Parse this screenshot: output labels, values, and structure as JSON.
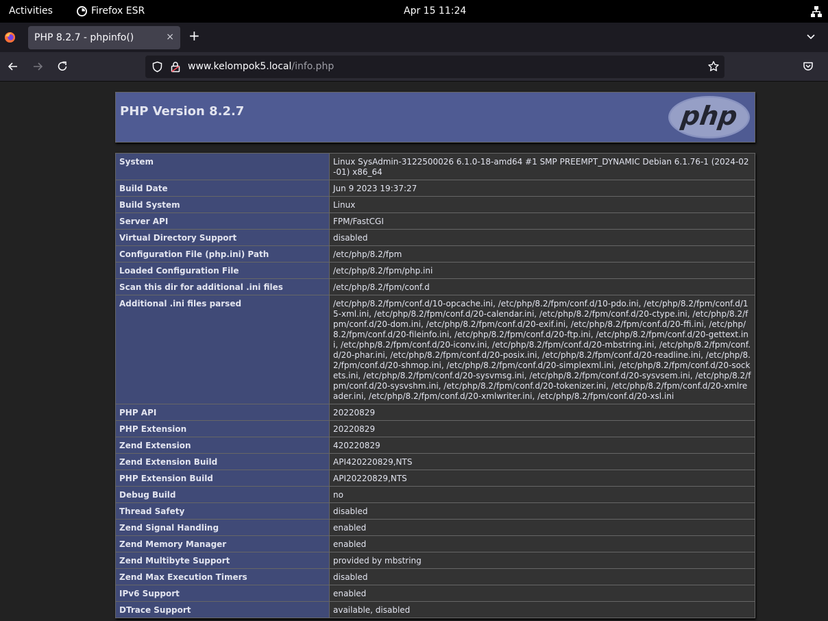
{
  "topbar": {
    "activities": "Activities",
    "app_name": "Firefox ESR",
    "clock": "Apr 15  11:24"
  },
  "browser": {
    "tab_title": "PHP 8.2.7 - phpinfo()",
    "tab_close": "×",
    "new_tab": "+",
    "url_host": "www.kelompok5.local",
    "url_path": "/info.php"
  },
  "page": {
    "heading": "PHP Version 8.2.7",
    "rows": [
      {
        "key": "System",
        "value": "Linux SysAdmin-3122500026 6.1.0-18-amd64 #1 SMP PREEMPT_DYNAMIC Debian 6.1.76-1 (2024-02-01) x86_64"
      },
      {
        "key": "Build Date",
        "value": "Jun 9 2023 19:37:27"
      },
      {
        "key": "Build System",
        "value": "Linux"
      },
      {
        "key": "Server API",
        "value": "FPM/FastCGI"
      },
      {
        "key": "Virtual Directory Support",
        "value": "disabled"
      },
      {
        "key": "Configuration File (php.ini) Path",
        "value": "/etc/php/8.2/fpm"
      },
      {
        "key": "Loaded Configuration File",
        "value": "/etc/php/8.2/fpm/php.ini"
      },
      {
        "key": "Scan this dir for additional .ini files",
        "value": "/etc/php/8.2/fpm/conf.d"
      },
      {
        "key": "Additional .ini files parsed",
        "value": "/etc/php/8.2/fpm/conf.d/10-opcache.ini, /etc/php/8.2/fpm/conf.d/10-pdo.ini, /etc/php/8.2/fpm/conf.d/15-xml.ini, /etc/php/8.2/fpm/conf.d/20-calendar.ini, /etc/php/8.2/fpm/conf.d/20-ctype.ini, /etc/php/8.2/fpm/conf.d/20-dom.ini, /etc/php/8.2/fpm/conf.d/20-exif.ini, /etc/php/8.2/fpm/conf.d/20-ffi.ini, /etc/php/8.2/fpm/conf.d/20-fileinfo.ini, /etc/php/8.2/fpm/conf.d/20-ftp.ini, /etc/php/8.2/fpm/conf.d/20-gettext.ini, /etc/php/8.2/fpm/conf.d/20-iconv.ini, /etc/php/8.2/fpm/conf.d/20-mbstring.ini, /etc/php/8.2/fpm/conf.d/20-phar.ini, /etc/php/8.2/fpm/conf.d/20-posix.ini, /etc/php/8.2/fpm/conf.d/20-readline.ini, /etc/php/8.2/fpm/conf.d/20-shmop.ini, /etc/php/8.2/fpm/conf.d/20-simplexml.ini, /etc/php/8.2/fpm/conf.d/20-sockets.ini, /etc/php/8.2/fpm/conf.d/20-sysvmsg.ini, /etc/php/8.2/fpm/conf.d/20-sysvsem.ini, /etc/php/8.2/fpm/conf.d/20-sysvshm.ini, /etc/php/8.2/fpm/conf.d/20-tokenizer.ini, /etc/php/8.2/fpm/conf.d/20-xmlreader.ini, /etc/php/8.2/fpm/conf.d/20-xmlwriter.ini, /etc/php/8.2/fpm/conf.d/20-xsl.ini"
      },
      {
        "key": "PHP API",
        "value": "20220829"
      },
      {
        "key": "PHP Extension",
        "value": "20220829"
      },
      {
        "key": "Zend Extension",
        "value": "420220829"
      },
      {
        "key": "Zend Extension Build",
        "value": "API420220829,NTS"
      },
      {
        "key": "PHP Extension Build",
        "value": "API20220829,NTS"
      },
      {
        "key": "Debug Build",
        "value": "no"
      },
      {
        "key": "Thread Safety",
        "value": "disabled"
      },
      {
        "key": "Zend Signal Handling",
        "value": "enabled"
      },
      {
        "key": "Zend Memory Manager",
        "value": "enabled"
      },
      {
        "key": "Zend Multibyte Support",
        "value": "provided by mbstring"
      },
      {
        "key": "Zend Max Execution Timers",
        "value": "disabled"
      },
      {
        "key": "IPv6 Support",
        "value": "enabled"
      },
      {
        "key": "DTrace Support",
        "value": "available, disabled"
      }
    ]
  },
  "colors": {
    "header_bg": "#4f5b93",
    "key_bg": "#404a77",
    "value_bg": "#333333",
    "page_bg": "#222222"
  }
}
